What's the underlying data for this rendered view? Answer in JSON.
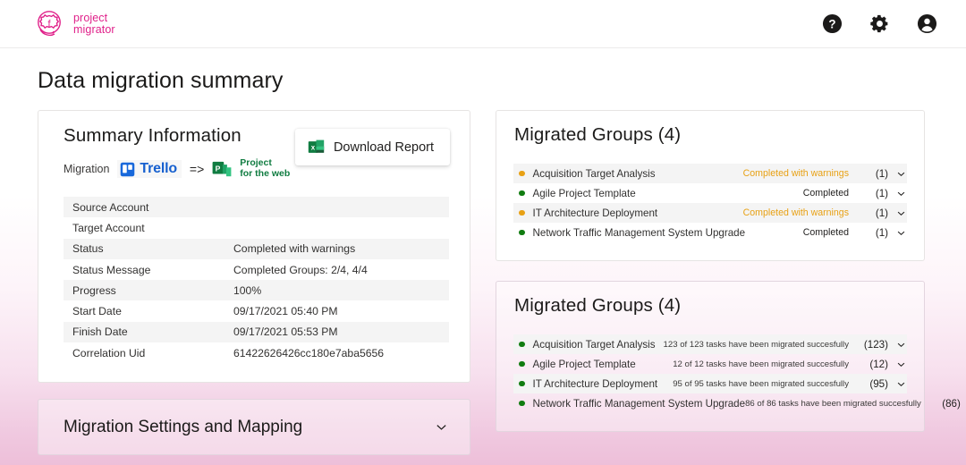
{
  "header": {
    "logo": {
      "line1": "project",
      "line2": "migrator",
      "color": "#e0218a"
    },
    "icons": [
      {
        "name": "help-icon",
        "label": "Help"
      },
      {
        "name": "gear-icon",
        "label": "Settings"
      },
      {
        "name": "account-icon",
        "label": "Account"
      }
    ]
  },
  "page": {
    "title": "Data migration summary"
  },
  "summary": {
    "title": "Summary Information",
    "migration_label": "Migration",
    "source_name": "Trello",
    "arrow": "=>",
    "target_line1": "Project",
    "target_line2": "for the web",
    "download_button": "Download Report",
    "rows": [
      {
        "key": "Source Account",
        "value": ""
      },
      {
        "key": "Target Account",
        "value": ""
      },
      {
        "key": "Status",
        "value": "Completed with warnings"
      },
      {
        "key": "Status Message",
        "value": "Completed Groups: 2/4, 4/4"
      },
      {
        "key": "Progress",
        "value": "100%"
      },
      {
        "key": "Start Date",
        "value": "09/17/2021 05:40 PM"
      },
      {
        "key": "Finish Date",
        "value": "09/17/2021 05:53 PM"
      },
      {
        "key": "Correlation Uid",
        "value": "61422626426cc180e7aba5656"
      }
    ]
  },
  "settings_panel": {
    "title": "Migration Settings and Mapping"
  },
  "groups_status": {
    "title": "Migrated Groups (4)",
    "rows": [
      {
        "name": "Acquisition Target Analysis",
        "status": "Completed with warnings",
        "state": "warn",
        "count": "(1)"
      },
      {
        "name": "Agile Project Template",
        "status": "Completed",
        "state": "ok",
        "count": "(1)"
      },
      {
        "name": "IT Architecture Deployment",
        "status": "Completed with warnings",
        "state": "warn",
        "count": "(1)"
      },
      {
        "name": "Network Traffic Management System Upgrade",
        "status": "Completed",
        "state": "ok",
        "count": "(1)"
      }
    ]
  },
  "groups_tasks": {
    "title": "Migrated Groups (4)",
    "rows": [
      {
        "name": "Acquisition Target Analysis",
        "status": "123 of 123 tasks have been migrated succesfully",
        "state": "ok",
        "count": "(123)"
      },
      {
        "name": "Agile Project Template",
        "status": "12 of 12 tasks have been migrated succesfully",
        "state": "ok",
        "count": "(12)"
      },
      {
        "name": "IT Architecture Deployment",
        "status": "95 of 95 tasks have been migrated succesfully",
        "state": "ok",
        "count": "(95)"
      },
      {
        "name": "Network Traffic Management System Upgrade",
        "status": "86 of 86 tasks have been migrated succesfully",
        "state": "ok",
        "count": "(86)"
      }
    ]
  },
  "colors": {
    "brand_pink": "#e0218a",
    "warning_orange": "#e8a114",
    "success_green": "#107c10",
    "trello_blue": "#1760cf",
    "project_green": "#107c41",
    "row_stripe": "#f4f4f4"
  }
}
